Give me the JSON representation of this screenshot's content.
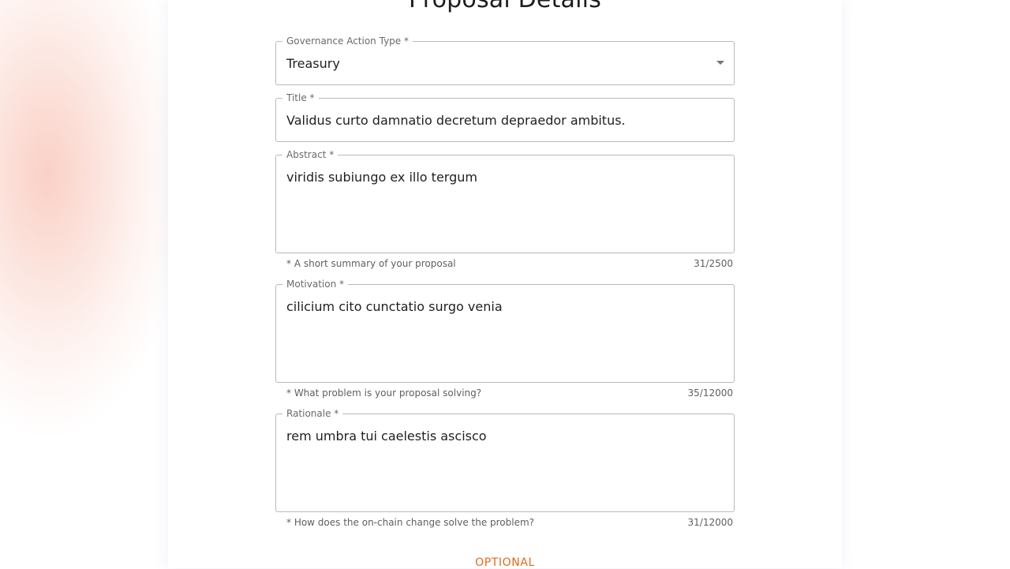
{
  "page": {
    "title": "Proposal Details"
  },
  "fields": {
    "governance_action_type": {
      "label": "Governance Action Type *",
      "value": "Treasury"
    },
    "title": {
      "label": "Title *",
      "value": "Validus curto damnatio decretum depraedor ambitus."
    },
    "abstract": {
      "label": "Abstract *",
      "value": "viridis subiungo ex illo tergum",
      "helper": "* A short summary of your proposal",
      "counter": "31/2500"
    },
    "motivation": {
      "label": "Motivation *",
      "value": "cilicium cito cunctatio surgo venia",
      "helper": "* What problem is your proposal solving?",
      "counter": "35/12000"
    },
    "rationale": {
      "label": "Rationale *",
      "value": "rem umbra tui caelestis ascisco",
      "helper": "* How does the on-chain change solve the problem?",
      "counter": "31/12000"
    }
  },
  "section": {
    "optional_label": "OPTIONAL"
  },
  "colors": {
    "accent": "#e06a1b",
    "border": "#b9b9b9"
  },
  "icons": {
    "dropdown": "chevron-down-icon"
  }
}
